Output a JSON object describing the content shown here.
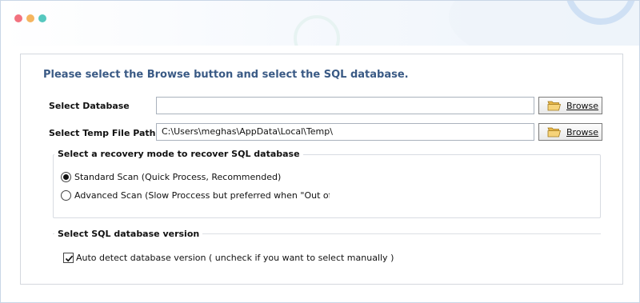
{
  "window": {
    "controls": [
      "close",
      "minimize",
      "maximize"
    ]
  },
  "panel": {
    "heading": "Please select the Browse button and select the SQL database.",
    "select_database": {
      "label": "Select Database",
      "value": "",
      "browse_label": "Browse"
    },
    "select_temp_path": {
      "label": "Select Temp File Path",
      "value": "C:\\Users\\meghas\\AppData\\Local\\Temp\\",
      "browse_label": "Browse"
    },
    "recovery_mode": {
      "title": "Select a recovery mode to recover SQL database",
      "options": [
        {
          "label": "Standard Scan (Quick Process, Recommended)",
          "selected": true
        },
        {
          "label": "Advanced Scan (Slow Proccess but preferred when \"Out of Memor",
          "selected": false
        }
      ]
    },
    "version": {
      "title": "Select SQL database version",
      "auto_detect_label": "Auto detect database version ( uncheck if you want to select manually )",
      "auto_detect_checked": true
    }
  },
  "colors": {
    "heading": "#3a5a85",
    "dot_red": "#f2727f",
    "dot_yellow": "#f5b55f",
    "dot_green": "#56c8bf"
  }
}
